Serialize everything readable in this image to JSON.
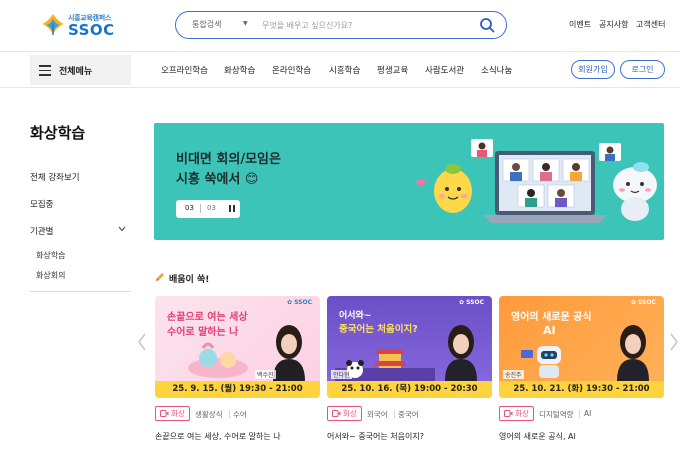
{
  "header": {
    "logo_sub": "시흥교육캠퍼스",
    "logo_main": "SSOC",
    "search": {
      "scope": "통합검색",
      "placeholder": "무엇을 배우고 싶으신가요?"
    },
    "util_links": [
      "이벤트",
      "공지사항",
      "고객센터"
    ]
  },
  "gnb": {
    "all_menu": "전체메뉴",
    "items": [
      "오프라인학습",
      "화상학습",
      "온라인학습",
      "시흥학습",
      "평생교육",
      "사람도서관",
      "소식나눔"
    ],
    "join": "회원가입",
    "login": "로그인"
  },
  "sidebar": {
    "title": "화상학습",
    "items": [
      "전체 강좌보기",
      "모집중",
      "기관별"
    ],
    "sub_items": [
      "화상학습",
      "화상회의"
    ]
  },
  "banner": {
    "line1": "비대면 회의/모임은",
    "line2": "시흥 쑥에서 😊",
    "current": "03",
    "total": "03"
  },
  "section": {
    "title": "배움이 쑥!"
  },
  "cards": [
    {
      "thumb_line1": "손끝으로 여는 세상",
      "thumb_line2": "수어로 말하는 나",
      "presenter": "백수진",
      "date": "25. 9. 15. (월) 19:30 - 21:00",
      "mode": "화상",
      "category": "생활상식",
      "subcategory": "수어",
      "title": "손끝으로 여는 세상, 수어로 말하는 나"
    },
    {
      "thumb_line1": "어서와~",
      "thumb_line2": "중국어는 처음이지?",
      "presenter": "안다현",
      "date": "25. 10. 16. (목) 19:00 - 20:30",
      "mode": "화상",
      "category": "외국어",
      "subcategory": "중국어",
      "title": "어서와~ 중국어는 처음이지?"
    },
    {
      "thumb_line1": "영어의 새로운 공식",
      "thumb_line2": "AI",
      "presenter": "송진주",
      "date": "25. 10. 21. (화) 19:30 - 21:00",
      "mode": "화상",
      "category": "디지털역량",
      "subcategory": "AI",
      "title": "영어의 새로운 공식, AI"
    }
  ],
  "colors": {
    "accent_blue": "#3c6fd3",
    "banner_teal": "#3dc4b8",
    "tag_pink": "#e3557a",
    "date_yellow": "#ffd33d"
  }
}
